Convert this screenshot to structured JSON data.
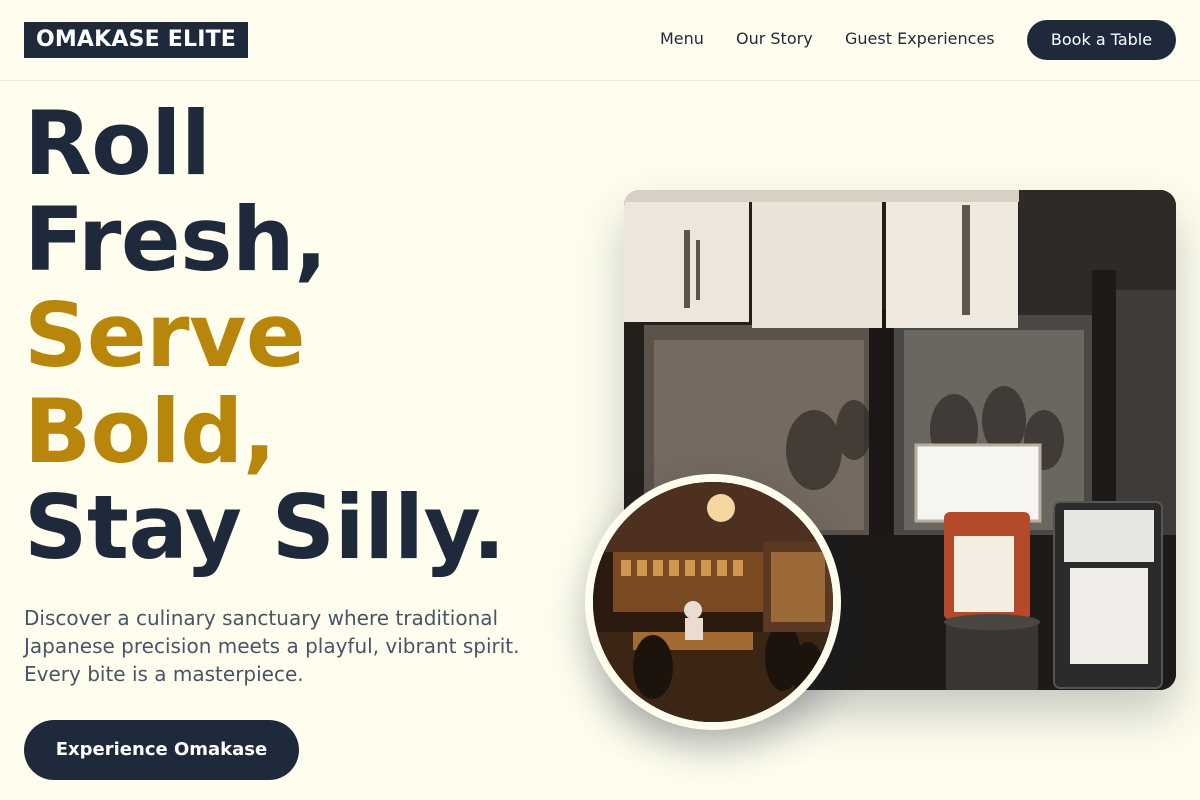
{
  "header": {
    "logo": "OMAKASE ELITE",
    "nav": [
      "Menu",
      "Our Story",
      "Guest Experiences"
    ],
    "book_label": "Book a Table"
  },
  "hero": {
    "headline_lines": [
      "Roll",
      "Fresh,",
      "Serve",
      "Bold,",
      "Stay Silly."
    ],
    "subtext": "Discover a culinary sanctuary where traditional Japanese precision meets a playful, vibrant spirit. Every bite is a masterpiece.",
    "cta_label": "Experience Omakase"
  },
  "images": {
    "main": "restaurant-storefront-photo",
    "secondary": "restaurant-interior-photo"
  },
  "colors": {
    "background": "#fffeee",
    "navy": "#1e293b",
    "gold": "#b8860b",
    "body_text": "#475569"
  }
}
